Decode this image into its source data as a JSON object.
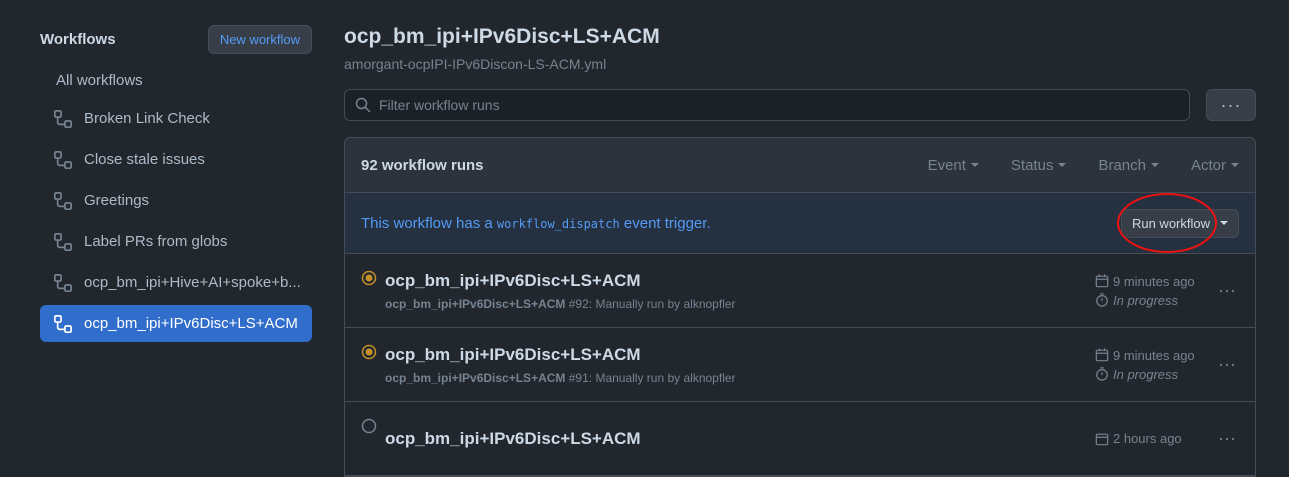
{
  "sidebar": {
    "title": "Workflows",
    "new_button": "New workflow",
    "all_label": "All workflows",
    "items": [
      {
        "label": "Broken Link Check"
      },
      {
        "label": "Close stale issues"
      },
      {
        "label": "Greetings"
      },
      {
        "label": "Label PRs from globs"
      },
      {
        "label": "ocp_bm_ipi+Hive+AI+spoke+b..."
      },
      {
        "label": "ocp_bm_ipi+IPv6Disc+LS+ACM"
      }
    ]
  },
  "main": {
    "title": "ocp_bm_ipi+IPv6Disc+LS+ACM",
    "file": "amorgant-ocpIPI-IPv6Discon-LS-ACM.yml",
    "filter_placeholder": "Filter workflow runs",
    "more": "···",
    "runs_count": "92 workflow runs",
    "filters": [
      "Event",
      "Status",
      "Branch",
      "Actor"
    ],
    "dispatch": {
      "prefix": "This workflow has a",
      "code": "workflow_dispatch",
      "suffix": "event trigger.",
      "button": "Run workflow"
    },
    "runs": [
      {
        "title": "ocp_bm_ipi+IPv6Disc+LS+ACM",
        "name": "ocp_bm_ipi+IPv6Disc+LS+ACM",
        "number": "#92",
        "desc": ": Manually run by alknopfler",
        "time": "9 minutes ago",
        "status": "In progress"
      },
      {
        "title": "ocp_bm_ipi+IPv6Disc+LS+ACM",
        "name": "ocp_bm_ipi+IPv6Disc+LS+ACM",
        "number": "#91",
        "desc": ": Manually run by alknopfler",
        "time": "9 minutes ago",
        "status": "In progress"
      },
      {
        "title": "ocp_bm_ipi+IPv6Disc+LS+ACM",
        "time": "2 hours ago"
      }
    ]
  },
  "colors": {
    "accent": "#539bf5",
    "active_item": "#316dca",
    "in_progress": "#c69026",
    "highlight": "#e11111"
  }
}
